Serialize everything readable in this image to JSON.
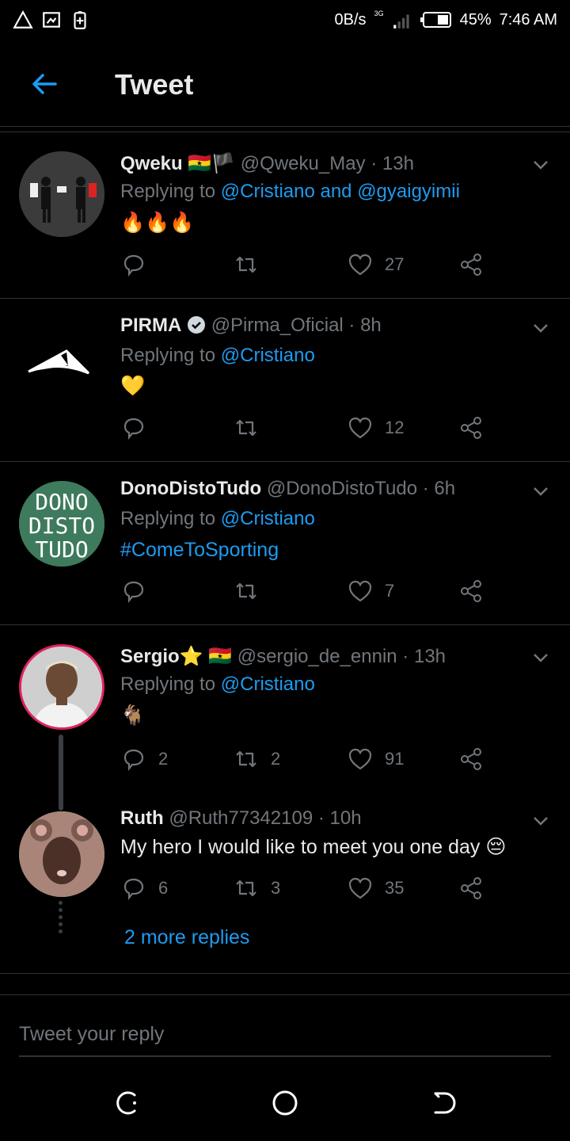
{
  "status_bar": {
    "speed": "0B/s",
    "network": "3G",
    "battery": "45%",
    "time": "7:46 AM"
  },
  "header": {
    "title": "Tweet"
  },
  "tweets": [
    {
      "name": "Qweku 🇬🇭🏴",
      "handle": "@Qweku_May",
      "time": "13h",
      "replying_prefix": "Replying to ",
      "replying_to": "@Cristiano and @gyaigyimii",
      "text": "🔥🔥🔥",
      "likes": "27"
    },
    {
      "name": "PIRMA",
      "handle": "@Pirma_Oficial",
      "time": "8h",
      "replying_prefix": "Replying to ",
      "replying_to": "@Cristiano",
      "text": "💛",
      "likes": "12"
    },
    {
      "name": "DonoDistoTudo",
      "handle": "@DonoDistoTudo",
      "time": "6h",
      "replying_prefix": "Replying to ",
      "replying_to": "@Cristiano",
      "text": "#ComeToSporting",
      "likes": "7",
      "avatar_text": [
        "DONO",
        "DISTO",
        "TUDO"
      ]
    },
    {
      "name": "Sergio⭐ 🇬🇭",
      "handle": "@sergio_de_ennin",
      "time": "13h",
      "replying_prefix": "Replying to ",
      "replying_to": "@Cristiano",
      "text": "🐐",
      "replies": "2",
      "retweets": "2",
      "likes": "91"
    },
    {
      "name": "Ruth",
      "handle": "@Ruth77342109",
      "time": "10h",
      "text": "My hero I would like to meet you one day 😔",
      "replies": "6",
      "retweets": "3",
      "likes": "35"
    }
  ],
  "more_replies": "2 more replies",
  "composer": {
    "placeholder": "Tweet your reply"
  },
  "colors": {
    "accent": "#1d9bf0",
    "background": "#000000",
    "muted": "#71767b"
  }
}
